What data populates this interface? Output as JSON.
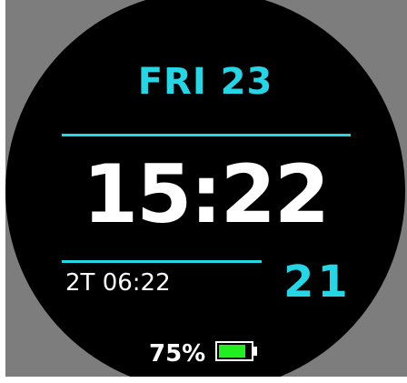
{
  "watchface": {
    "date": "FRI 23",
    "time": "15:22",
    "second_timezone": "2T 06:22",
    "seconds": "21",
    "battery": {
      "percent_label": "75%",
      "level": 0.85,
      "fill_color": "#22ee22"
    },
    "colors": {
      "accent": "#25d6e6",
      "background": "#000000",
      "text": "#ffffff",
      "bezel": "#7d7d7d"
    }
  }
}
